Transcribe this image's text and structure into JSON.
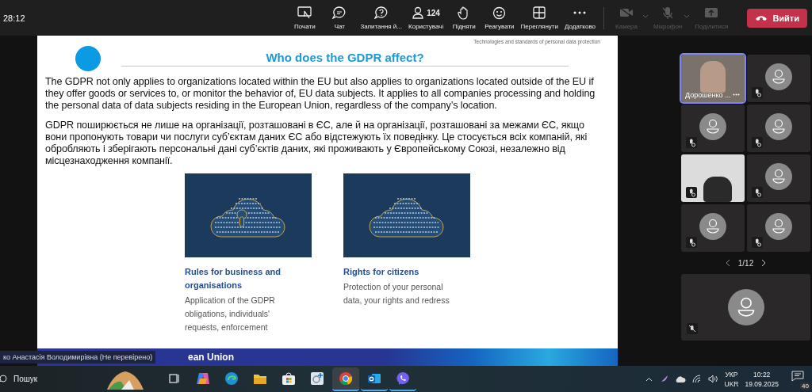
{
  "call": {
    "timer": "28:12",
    "tools": [
      {
        "kind": "share",
        "label": "Почати",
        "disabled": false
      },
      {
        "kind": "chat",
        "label": "Чат",
        "disabled": false
      },
      {
        "kind": "qa",
        "label": "Запитання й...",
        "disabled": false
      },
      {
        "kind": "people",
        "label": "Користувачі",
        "count": "124",
        "disabled": false
      },
      {
        "kind": "hand",
        "label": "Підняти",
        "disabled": false
      },
      {
        "kind": "react",
        "label": "Реагувати",
        "disabled": false
      },
      {
        "kind": "view",
        "label": "Переглянути",
        "disabled": false
      },
      {
        "kind": "more",
        "label": "Додатково",
        "disabled": false
      },
      {
        "kind": "camera",
        "label": "Камера",
        "disabled": true
      },
      {
        "kind": "mic",
        "label": "Мікрофон",
        "disabled": true
      },
      {
        "kind": "present",
        "label": "Поділитися",
        "disabled": true
      }
    ],
    "leave": "Вийти"
  },
  "slide": {
    "header": "Technologies and standards of personal data protection",
    "title": "Who does the GDPR affect?",
    "paragraphs": [
      "The GDPR not only applies to organizations located within the EU but also applies to organizations located outside of the EU if they offer goods or services to, or monitor the behavior of, EU data subjects. It applies to all companies processing and holding the personal data of data subjects residing in the European Union, regardless of the company’s location.",
      "GDPR поширюється не лише на організації, розташовані в ЄС, але й на організації, розташовані за межами ЄС, якщо вони пропонують товари чи послуги суб’єктам даних ЄС або відстежують їх поведінку. Це стосується всіх компаній, які обробляють і зберігають персональні дані суб’єктів даних, які проживають у Європейському Союзі, незалежно від місцезнаходження компанії."
    ],
    "cards": [
      {
        "kind": "lock",
        "title": "Rules for business and organisations",
        "text": "Application of the GDPR obligations, individuals' requests, enforcement"
      },
      {
        "kind": "plain",
        "title": "Rights for citizens",
        "text": "Protection of your personal data, your rights and redress"
      }
    ],
    "footer": "ean Union"
  },
  "caption": "ко Анастасія Володимирівна (Не перевірено)",
  "participants": {
    "tiles": [
      {
        "kind": "video",
        "name": "Дорошенко ...",
        "selected": true,
        "muted": false
      },
      {
        "kind": "avatar",
        "selected": false,
        "muted": true
      },
      {
        "kind": "avatar",
        "selected": false,
        "muted": true
      },
      {
        "kind": "avatar",
        "selected": false,
        "muted": true
      },
      {
        "kind": "video",
        "selected": false,
        "muted": true
      },
      {
        "kind": "avatar",
        "selected": false,
        "muted": true
      },
      {
        "kind": "avatar",
        "selected": false,
        "muted": true
      },
      {
        "kind": "avatar",
        "selected": false,
        "muted": true
      }
    ],
    "pager": "1/12",
    "spotlight": {
      "kind": "avatar",
      "muted": true
    }
  },
  "taskbar": {
    "search": "Пошук",
    "apps": [
      {
        "kind": "taskview",
        "selected": false,
        "running": false
      },
      {
        "kind": "copilot",
        "selected": false,
        "running": false
      },
      {
        "kind": "edge",
        "selected": false,
        "running": false
      },
      {
        "kind": "folder",
        "selected": false,
        "running": false
      },
      {
        "kind": "store",
        "selected": false,
        "running": false
      },
      {
        "kind": "snip",
        "selected": false,
        "running": false
      },
      {
        "kind": "chrome",
        "selected": true,
        "running": true
      },
      {
        "kind": "outlook",
        "selected": false,
        "running": true
      },
      {
        "kind": "viber",
        "selected": false,
        "running": true
      }
    ],
    "lang": [
      "УКР",
      "UKR"
    ],
    "time": "10:22",
    "date": "19.09.2025",
    "notifications": "40"
  }
}
